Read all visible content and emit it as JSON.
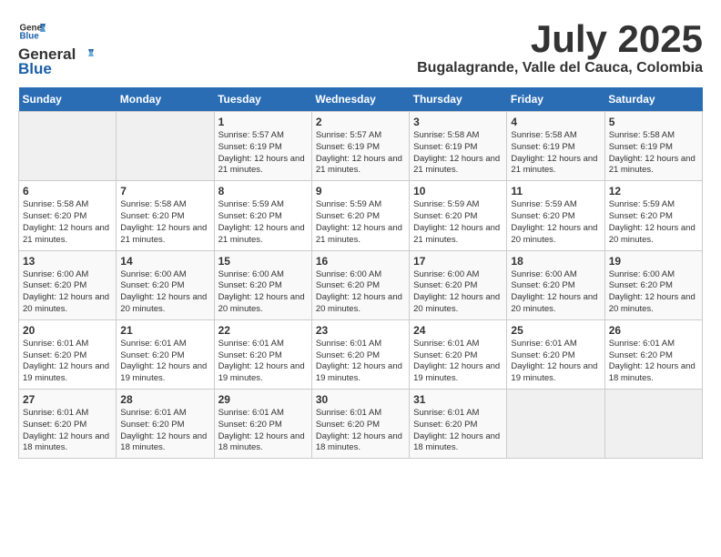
{
  "header": {
    "logo_general": "General",
    "logo_blue": "Blue",
    "month_title": "July 2025",
    "subtitle": "Bugalagrande, Valle del Cauca, Colombia"
  },
  "calendar": {
    "weekdays": [
      "Sunday",
      "Monday",
      "Tuesday",
      "Wednesday",
      "Thursday",
      "Friday",
      "Saturday"
    ],
    "weeks": [
      [
        {
          "day": "",
          "empty": true
        },
        {
          "day": "",
          "empty": true
        },
        {
          "day": "1",
          "sunrise": "5:57 AM",
          "sunset": "6:19 PM",
          "daylight": "12 hours and 21 minutes."
        },
        {
          "day": "2",
          "sunrise": "5:57 AM",
          "sunset": "6:19 PM",
          "daylight": "12 hours and 21 minutes."
        },
        {
          "day": "3",
          "sunrise": "5:58 AM",
          "sunset": "6:19 PM",
          "daylight": "12 hours and 21 minutes."
        },
        {
          "day": "4",
          "sunrise": "5:58 AM",
          "sunset": "6:19 PM",
          "daylight": "12 hours and 21 minutes."
        },
        {
          "day": "5",
          "sunrise": "5:58 AM",
          "sunset": "6:19 PM",
          "daylight": "12 hours and 21 minutes."
        }
      ],
      [
        {
          "day": "6",
          "sunrise": "5:58 AM",
          "sunset": "6:20 PM",
          "daylight": "12 hours and 21 minutes."
        },
        {
          "day": "7",
          "sunrise": "5:58 AM",
          "sunset": "6:20 PM",
          "daylight": "12 hours and 21 minutes."
        },
        {
          "day": "8",
          "sunrise": "5:59 AM",
          "sunset": "6:20 PM",
          "daylight": "12 hours and 21 minutes."
        },
        {
          "day": "9",
          "sunrise": "5:59 AM",
          "sunset": "6:20 PM",
          "daylight": "12 hours and 21 minutes."
        },
        {
          "day": "10",
          "sunrise": "5:59 AM",
          "sunset": "6:20 PM",
          "daylight": "12 hours and 21 minutes."
        },
        {
          "day": "11",
          "sunrise": "5:59 AM",
          "sunset": "6:20 PM",
          "daylight": "12 hours and 20 minutes."
        },
        {
          "day": "12",
          "sunrise": "5:59 AM",
          "sunset": "6:20 PM",
          "daylight": "12 hours and 20 minutes."
        }
      ],
      [
        {
          "day": "13",
          "sunrise": "6:00 AM",
          "sunset": "6:20 PM",
          "daylight": "12 hours and 20 minutes."
        },
        {
          "day": "14",
          "sunrise": "6:00 AM",
          "sunset": "6:20 PM",
          "daylight": "12 hours and 20 minutes."
        },
        {
          "day": "15",
          "sunrise": "6:00 AM",
          "sunset": "6:20 PM",
          "daylight": "12 hours and 20 minutes."
        },
        {
          "day": "16",
          "sunrise": "6:00 AM",
          "sunset": "6:20 PM",
          "daylight": "12 hours and 20 minutes."
        },
        {
          "day": "17",
          "sunrise": "6:00 AM",
          "sunset": "6:20 PM",
          "daylight": "12 hours and 20 minutes."
        },
        {
          "day": "18",
          "sunrise": "6:00 AM",
          "sunset": "6:20 PM",
          "daylight": "12 hours and 20 minutes."
        },
        {
          "day": "19",
          "sunrise": "6:00 AM",
          "sunset": "6:20 PM",
          "daylight": "12 hours and 20 minutes."
        }
      ],
      [
        {
          "day": "20",
          "sunrise": "6:01 AM",
          "sunset": "6:20 PM",
          "daylight": "12 hours and 19 minutes."
        },
        {
          "day": "21",
          "sunrise": "6:01 AM",
          "sunset": "6:20 PM",
          "daylight": "12 hours and 19 minutes."
        },
        {
          "day": "22",
          "sunrise": "6:01 AM",
          "sunset": "6:20 PM",
          "daylight": "12 hours and 19 minutes."
        },
        {
          "day": "23",
          "sunrise": "6:01 AM",
          "sunset": "6:20 PM",
          "daylight": "12 hours and 19 minutes."
        },
        {
          "day": "24",
          "sunrise": "6:01 AM",
          "sunset": "6:20 PM",
          "daylight": "12 hours and 19 minutes."
        },
        {
          "day": "25",
          "sunrise": "6:01 AM",
          "sunset": "6:20 PM",
          "daylight": "12 hours and 19 minutes."
        },
        {
          "day": "26",
          "sunrise": "6:01 AM",
          "sunset": "6:20 PM",
          "daylight": "12 hours and 18 minutes."
        }
      ],
      [
        {
          "day": "27",
          "sunrise": "6:01 AM",
          "sunset": "6:20 PM",
          "daylight": "12 hours and 18 minutes."
        },
        {
          "day": "28",
          "sunrise": "6:01 AM",
          "sunset": "6:20 PM",
          "daylight": "12 hours and 18 minutes."
        },
        {
          "day": "29",
          "sunrise": "6:01 AM",
          "sunset": "6:20 PM",
          "daylight": "12 hours and 18 minutes."
        },
        {
          "day": "30",
          "sunrise": "6:01 AM",
          "sunset": "6:20 PM",
          "daylight": "12 hours and 18 minutes."
        },
        {
          "day": "31",
          "sunrise": "6:01 AM",
          "sunset": "6:20 PM",
          "daylight": "12 hours and 18 minutes."
        },
        {
          "day": "",
          "empty": true
        },
        {
          "day": "",
          "empty": true
        }
      ]
    ]
  }
}
